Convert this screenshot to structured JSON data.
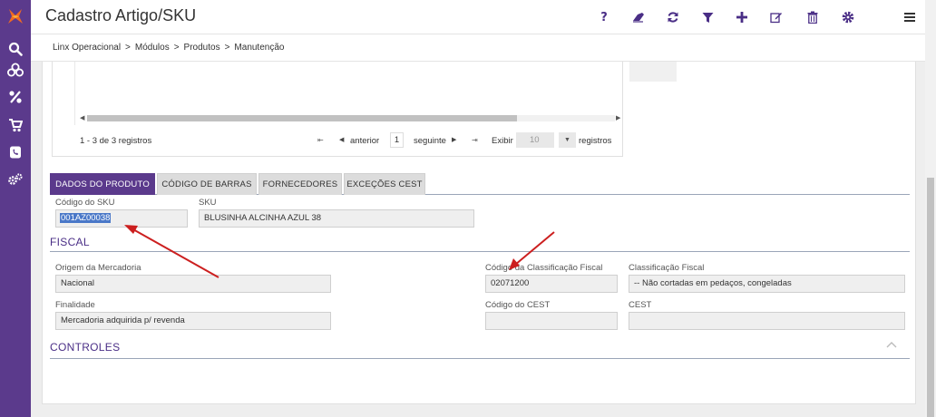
{
  "header": {
    "title": "Cadastro Artigo/SKU",
    "toolbar_icons": [
      "help-icon",
      "eraser-icon",
      "refresh-icon",
      "filter-icon",
      "add-icon",
      "edit-icon",
      "delete-icon",
      "gear-icon",
      "menu-icon"
    ],
    "help_glyph": "?"
  },
  "breadcrumb": [
    "Linx Operacional",
    "Módulos",
    "Produtos",
    "Manutenção"
  ],
  "breadcrumb_sep": ">",
  "sidebar": {
    "items": [
      "search-icon",
      "boxes-icon",
      "percent-icon",
      "cart-icon",
      "phone-icon",
      "gears-icon"
    ]
  },
  "grid": {
    "records": "1 - 3 de 3 registros",
    "first": "⇤",
    "prev": "anterior",
    "page": "1",
    "next": "seguinte",
    "last": "⇥",
    "show": "Exibir",
    "page_size": "10",
    "per_page": "registros"
  },
  "tabs": [
    {
      "label": "DADOS DO PRODUTO",
      "active": true
    },
    {
      "label": "CÓDIGO DE BARRAS",
      "active": false
    },
    {
      "label": "FORNECEDORES",
      "active": false
    },
    {
      "label": "EXCEÇÕES CEST",
      "active": false
    }
  ],
  "product": {
    "sku_code_label": "Código do SKU",
    "sku_code_value": "001AZ00038",
    "sku_label": "SKU",
    "sku_value": "BLUSINHA ALCINHA AZUL 38"
  },
  "fiscal": {
    "title": "FISCAL",
    "origin_label": "Origem da Mercadoria",
    "origin_value": "Nacional",
    "purpose_label": "Finalidade",
    "purpose_value": "Mercadoria adquirida p/ revenda",
    "class_code_label": "Código da Classificação Fiscal",
    "class_code_value": "02071200",
    "class_label": "Classificação Fiscal",
    "class_value": "-- Não cortadas em pedaços, congeladas",
    "cest_code_label": "Código do CEST",
    "cest_code_value": "",
    "cest_label": "CEST",
    "cest_value": ""
  },
  "controls": {
    "title": "CONTROLES"
  },
  "colors": {
    "sidebar": "#5b3a8c",
    "accent": "#4a2e86",
    "tab_active": "#5b3a8c",
    "annotation_arrow": "#cc1f1f"
  }
}
